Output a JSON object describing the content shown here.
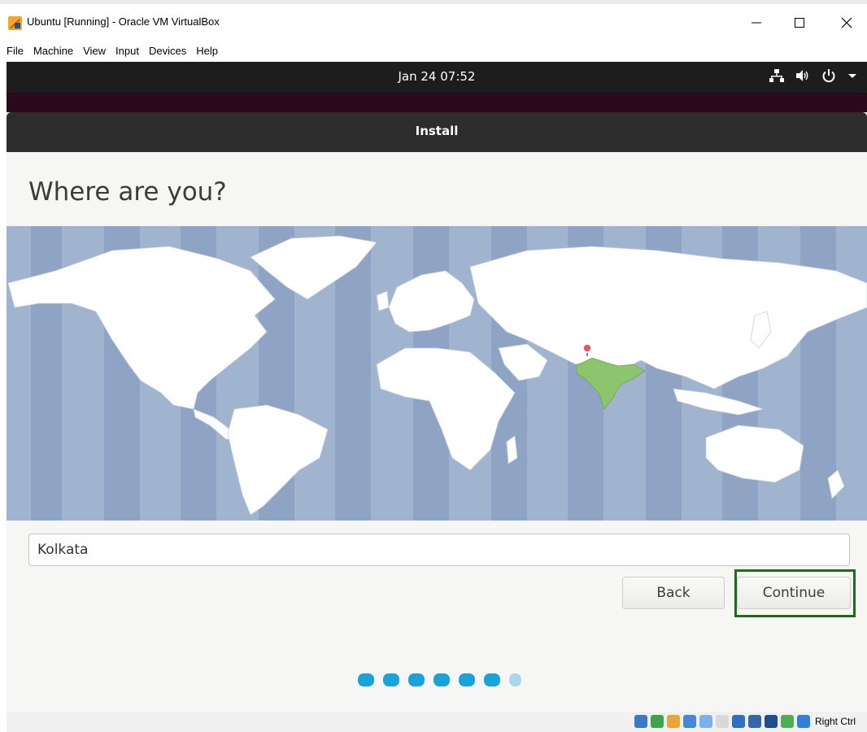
{
  "window": {
    "title": "Ubuntu [Running] - Oracle VM VirtualBox",
    "controls": [
      "minimize-icon",
      "maximize-icon",
      "close-icon"
    ]
  },
  "menubar": {
    "items": [
      "File",
      "Machine",
      "View",
      "Input",
      "Devices",
      "Help"
    ]
  },
  "topbar": {
    "clock": "Jan 24  07:52",
    "tray_icons": [
      "network-icon",
      "volume-icon",
      "power-icon",
      "chevron-down-icon"
    ]
  },
  "installer": {
    "header_title": "Install",
    "heading": "Where are you?",
    "map": {
      "selected_region": "India",
      "selected_color": "#8cc56d",
      "pin_color": "#e35a5a"
    },
    "timezone_input": {
      "value": "Kolkata"
    },
    "back_label": "Back",
    "continue_label": "Continue",
    "progress": {
      "total_steps": 7,
      "completed_steps": 6
    }
  },
  "statusbar": {
    "host_key": "Right Ctrl"
  },
  "colors": {
    "accent": "#19a3d8",
    "highlight_border": "#1e6b1e",
    "gnome_bar": "#1d1d1d",
    "header_bar": "#2d2d2d",
    "ocean": "#a0b3cf"
  }
}
